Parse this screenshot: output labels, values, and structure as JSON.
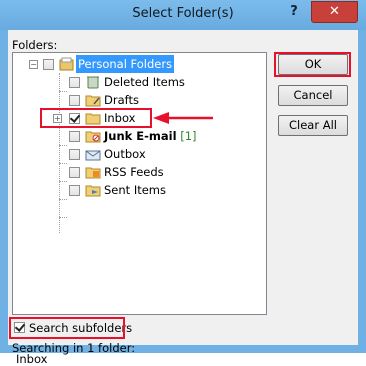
{
  "window": {
    "title": "Select Folder(s)",
    "help_glyph": "?",
    "close_glyph": "✕"
  },
  "folders_label": "Folders:",
  "tree": {
    "root": {
      "label": "Personal Folders",
      "expander": "−"
    },
    "items": [
      {
        "label": "Deleted Items",
        "icon": "deleted-items-icon"
      },
      {
        "label": "Drafts",
        "icon": "folder-icon"
      },
      {
        "label": "Inbox",
        "icon": "folder-icon",
        "checked": true,
        "expander": "+"
      },
      {
        "label": "Junk E-mail",
        "count": "[1]",
        "icon": "junk-folder-icon"
      },
      {
        "label": "Outbox",
        "icon": "outbox-icon"
      },
      {
        "label": "RSS Feeds",
        "icon": "rss-folder-icon"
      },
      {
        "label": "Sent Items",
        "icon": "sent-items-icon"
      }
    ]
  },
  "buttons": {
    "ok": "OK",
    "cancel": "Cancel",
    "clear_all": "Clear All"
  },
  "search_subfolders": {
    "label": "Search subfolders",
    "checked": true
  },
  "status": {
    "line1": "Searching in 1 folder:",
    "line2": "Inbox"
  },
  "colors": {
    "highlight": "#e8102a",
    "selection": "#3399ff",
    "titlebar": "#6fb1e4"
  }
}
